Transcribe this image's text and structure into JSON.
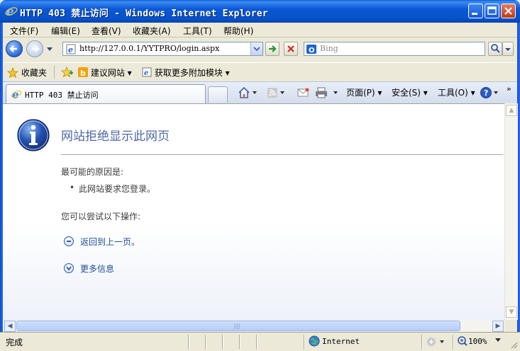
{
  "window": {
    "title": "HTTP 403 禁止访问 - Windows Internet Explorer"
  },
  "menubar": {
    "items": [
      "文件(F)",
      "编辑(E)",
      "查看(V)",
      "收藏夹(A)",
      "工具(T)",
      "帮助(H)"
    ]
  },
  "addressbar": {
    "url": "http://127.0.0.1/YYTPRO/login.aspx",
    "search_placeholder": "Bing"
  },
  "favorites": {
    "favorites_label": "收藏夹",
    "items": [
      "建议网站 ▾",
      "获取更多附加模块 ▾"
    ]
  },
  "tabs": {
    "active_tab_label": "HTTP 403 禁止访问"
  },
  "commandbar": {
    "page_label": "页面(P) ▾",
    "safety_label": "安全(S) ▾",
    "tools_label": "工具(O) ▾"
  },
  "error_page": {
    "title": "网站拒绝显示此网页",
    "cause_heading": "最可能的原因是:",
    "cause_item": "此网站要求您登录。",
    "try_heading": "您可以尝试以下操作:",
    "back_link": "返回到上一页。",
    "more_info_link": "更多信息"
  },
  "statusbar": {
    "status": "完成",
    "zone": "Internet",
    "zoom": "100%"
  },
  "colors": {
    "titlebar": "#0a58d6",
    "error_title": "#4c69a7",
    "link": "#1e4e9a"
  }
}
